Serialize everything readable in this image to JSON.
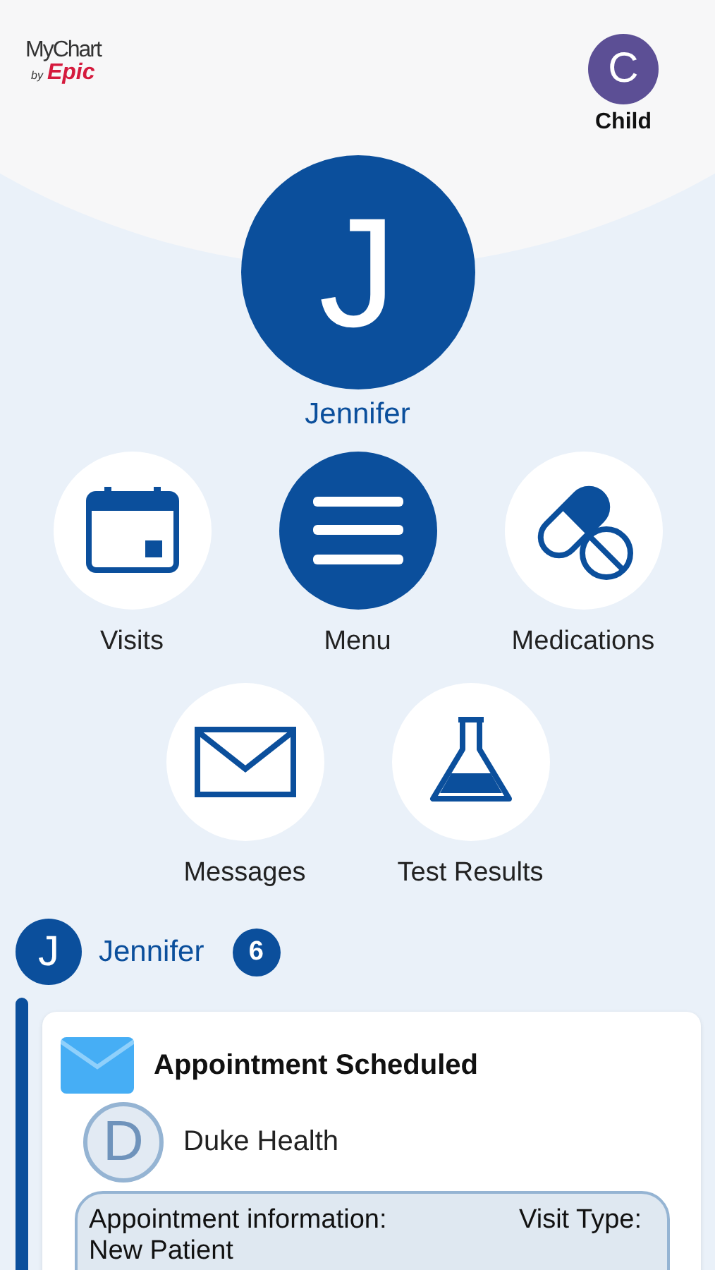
{
  "header": {
    "logo": {
      "name": "MyChart",
      "by": "by",
      "brand": "Epic"
    },
    "proxy": {
      "initial": "C",
      "label": "Child",
      "color": "#5c4f95"
    }
  },
  "patient": {
    "initial": "J",
    "name": "Jennifer"
  },
  "shortcuts": [
    {
      "kind": "calendar",
      "label": "Visits"
    },
    {
      "kind": "menu",
      "label": "Menu"
    },
    {
      "kind": "pills",
      "label": "Medications"
    },
    {
      "kind": "mail",
      "label": "Messages"
    },
    {
      "kind": "flask",
      "label": "Test Results"
    }
  ],
  "feed": {
    "initial": "J",
    "name": "Jennifer",
    "count": "6",
    "cards": [
      {
        "title": "Appointment Scheduled",
        "org_initial": "D",
        "org": "Duke Health",
        "body": [
          "Appointment information:",
          "Visit Type:",
          "New Patient"
        ]
      }
    ]
  }
}
